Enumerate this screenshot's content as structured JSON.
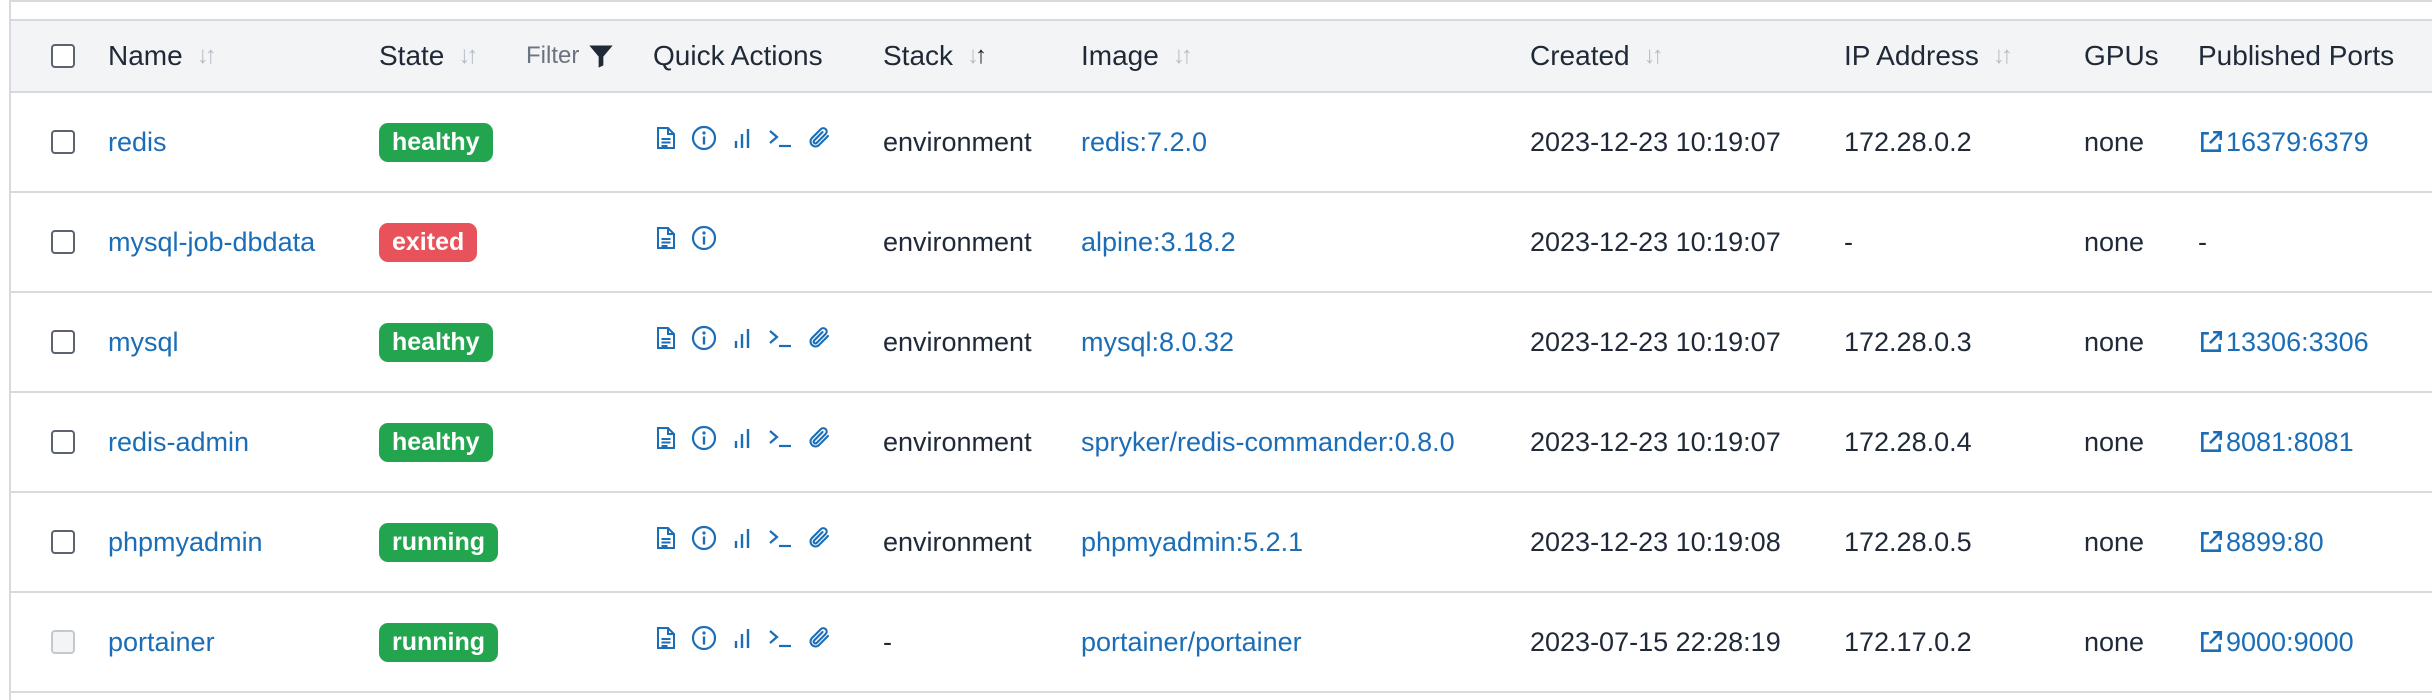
{
  "table": {
    "columns": {
      "name": "Name",
      "state": "State",
      "filter": "Filter",
      "quick_actions": "Quick Actions",
      "stack": "Stack",
      "image": "Image",
      "created": "Created",
      "ip_address": "IP Address",
      "gpus": "GPUs",
      "published_ports": "Published Ports"
    },
    "rows": [
      {
        "name": "redis",
        "state": "healthy",
        "stack": "environment",
        "image": "redis:7.2.0",
        "created": "2023-12-23 10:19:07",
        "ip": "172.28.0.2",
        "gpus": "none",
        "ports": "16379:6379"
      },
      {
        "name": "mysql-job-dbdata",
        "state": "exited",
        "stack": "environment",
        "image": "alpine:3.18.2",
        "created": "2023-12-23 10:19:07",
        "ip": "-",
        "gpus": "none",
        "ports": "-"
      },
      {
        "name": "mysql",
        "state": "healthy",
        "stack": "environment",
        "image": "mysql:8.0.32",
        "created": "2023-12-23 10:19:07",
        "ip": "172.28.0.3",
        "gpus": "none",
        "ports": "13306:3306"
      },
      {
        "name": "redis-admin",
        "state": "healthy",
        "stack": "environment",
        "image": "spryker/redis-commander:0.8.0",
        "created": "2023-12-23 10:19:07",
        "ip": "172.28.0.4",
        "gpus": "none",
        "ports": "8081:8081"
      },
      {
        "name": "phpmyadmin",
        "state": "running",
        "stack": "environment",
        "image": "phpmyadmin:5.2.1",
        "created": "2023-12-23 10:19:08",
        "ip": "172.28.0.5",
        "gpus": "none",
        "ports": "8899:80"
      },
      {
        "name": "portainer",
        "state": "running",
        "stack": "-",
        "image": "portainer/portainer",
        "created": "2023-07-15 22:28:19",
        "ip": "172.17.0.2",
        "gpus": "none",
        "ports": "9000:9000"
      }
    ]
  },
  "row_actions": [
    [
      "logs-icon",
      "inspect-icon",
      "stats-icon",
      "console-icon",
      "attach-icon"
    ],
    [
      "logs-icon",
      "inspect-icon"
    ],
    [
      "logs-icon",
      "inspect-icon",
      "stats-icon",
      "console-icon",
      "attach-icon"
    ],
    [
      "logs-icon",
      "inspect-icon",
      "stats-icon",
      "console-icon",
      "attach-icon"
    ],
    [
      "logs-icon",
      "inspect-icon",
      "stats-icon",
      "console-icon",
      "attach-icon"
    ],
    [
      "logs-icon",
      "inspect-icon",
      "stats-icon",
      "console-icon",
      "attach-icon"
    ]
  ],
  "colors": {
    "link": "#1a6db6",
    "badge_green": "#23a550",
    "badge_red": "#e8525a",
    "header_bg": "#f3f4f6",
    "border": "#d6d9de"
  }
}
